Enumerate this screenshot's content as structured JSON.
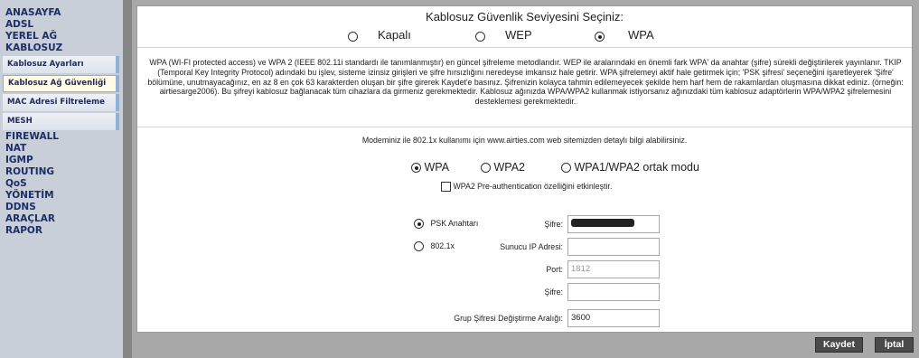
{
  "sidebar": {
    "nav_top": [
      "ANASAYFA",
      "ADSL",
      "YEREL AĞ",
      "KABLOSUZ"
    ],
    "sub_items": [
      "Kablosuz Ayarları",
      "Kablosuz Ağ Güvenliği",
      "MAC Adresi Filtreleme",
      "MESH"
    ],
    "active_sub": "Kablosuz Ağ Güvenliği",
    "nav_bottom": [
      "FIREWALL",
      "NAT",
      "IGMP",
      "ROUTING",
      "QoS",
      "YÖNETİM",
      "DDNS",
      "ARAÇLAR",
      "RAPOR"
    ]
  },
  "security": {
    "title": "Kablosuz Güvenlik Seviyesini Seçiniz:",
    "options": [
      "Kapalı",
      "WEP",
      "WPA"
    ],
    "selected": "WPA"
  },
  "description": "WPA (WI-FI protected access) ve WPA 2 (IEEE 802.11i standardı ile tanımlanmıştır) en güncel şifreleme metodlarıdır. WEP ile aralarındaki en önemli fark WPA' da anahtar (şifre) sürekli değiştirilerek yayınlanır. TKIP (Temporal Key Integrity Protocol) adındaki bu işlev, sisteme izinsiz girişleri ve şifre hırsızlığını neredeyse imkansız hale getirir. WPA şifrelemeyi aktif hale getirmek için; 'PSK şifresi' seçeneğini işaretleyerek 'Şifre' bölümüne, unutmayacağınız, en az 8 en çok 63 karakterden oluşan bir şifre girerek Kaydet'e basınız. Şifrenizin kolayca tahmin edilemeyecek şekilde hem harf hem de rakamlardan oluşmasına dikkat ediniz. (örneğin: airtiesarge2006). Bu şifreyi kablosuz bağlanacak tüm cihazlara da girmeniz gerekmektedir. Kablosuz ağınızda WPA/WPA2 kullanmak istiyorsanız ağınızdaki tüm kablosuz adaptörlerin WPA/WPA2 şifrelemesini desteklemesi gerekmektedir.",
  "info": "Modeminiz ile 802.1x kullanımı için www.airties.com web sitemizden detaylı bilgi alabilirsiniz.",
  "wpa_modes": {
    "options": [
      "WPA",
      "WPA2",
      "WPA1/WPA2 ortak modu"
    ],
    "selected": "WPA"
  },
  "preauth_label": "WPA2 Pre-authentication özelliğini etkinleştir.",
  "auth": {
    "psk_label": "PSK Anahtarı",
    "dot1x_label": "802.1x",
    "selected": "PSK Anahtarı",
    "password_label": "Şifre:",
    "server_ip_label": "Sunucu IP Adresi:",
    "server_ip_value": "",
    "port_label": "Port:",
    "port_value": "1812",
    "secret_label": "Şifre:",
    "secret_value": "",
    "group_interval_label": "Grup Şifresi Değiştirme Aralığı:",
    "group_interval_value": "3600"
  },
  "buttons": {
    "save": "Kaydet",
    "cancel": "İptal"
  }
}
